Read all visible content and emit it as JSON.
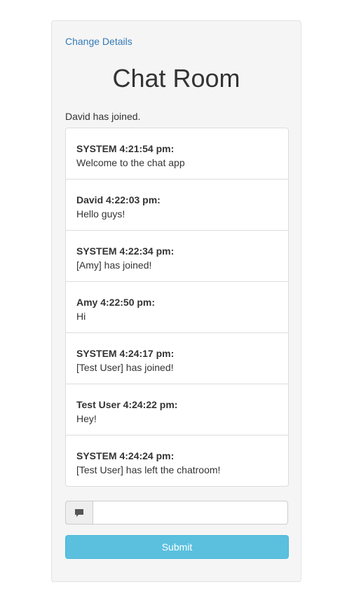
{
  "header": {
    "change_details_link": "Change Details",
    "title": "Chat Room",
    "status": "David has joined."
  },
  "messages": [
    {
      "header": "SYSTEM 4:21:54 pm:",
      "text": "Welcome to the chat app"
    },
    {
      "header": "David 4:22:03 pm:",
      "text": "Hello guys!"
    },
    {
      "header": "SYSTEM 4:22:34 pm:",
      "text": "[Amy] has joined!"
    },
    {
      "header": "Amy 4:22:50 pm:",
      "text": "Hi"
    },
    {
      "header": "SYSTEM 4:24:17 pm:",
      "text": "[Test User] has joined!"
    },
    {
      "header": "Test User 4:24:22 pm:",
      "text": "Hey!"
    },
    {
      "header": "SYSTEM 4:24:24 pm:",
      "text": "[Test User] has left the chatroom!"
    }
  ],
  "composer": {
    "icon": "comment-icon",
    "value": "",
    "placeholder": "",
    "submit_label": "Submit"
  },
  "colors": {
    "link": "#337ab7",
    "submit_bg": "#5bc0de",
    "panel_bg": "#f5f5f5"
  }
}
